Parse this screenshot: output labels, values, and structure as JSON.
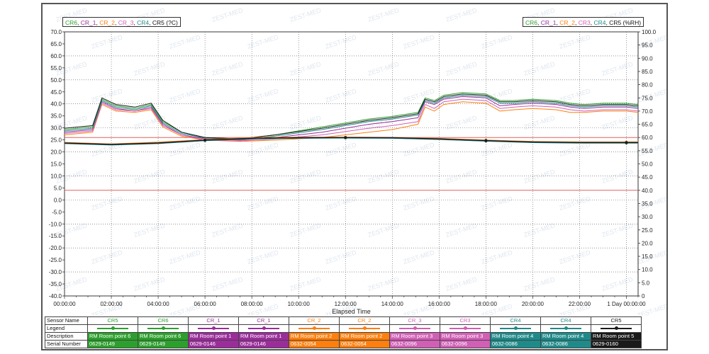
{
  "legend_left": {
    "items": [
      {
        "text": "CR6",
        "color": "#2ca02c"
      },
      {
        "text": ", ",
        "color": "#111111"
      },
      {
        "text": "CR_1",
        "color": "#9b2d9b"
      },
      {
        "text": ", ",
        "color": "#111111"
      },
      {
        "text": "CR_2",
        "color": "#ff7f0e"
      },
      {
        "text": ", ",
        "color": "#111111"
      },
      {
        "text": "CR_3",
        "color": "#d15fb6"
      },
      {
        "text": ", ",
        "color": "#111111"
      },
      {
        "text": "CR4",
        "color": "#1f8a8a"
      },
      {
        "text": ", CR5 (?C)",
        "color": "#111111"
      }
    ]
  },
  "legend_right": {
    "items": [
      {
        "text": "CR6",
        "color": "#2ca02c"
      },
      {
        "text": ", ",
        "color": "#111111"
      },
      {
        "text": "CR_1",
        "color": "#9b2d9b"
      },
      {
        "text": ", ",
        "color": "#111111"
      },
      {
        "text": "CR_2",
        "color": "#ff7f0e"
      },
      {
        "text": ", ",
        "color": "#111111"
      },
      {
        "text": "CR3",
        "color": "#d15fb6"
      },
      {
        "text": ", ",
        "color": "#111111"
      },
      {
        "text": "CR4",
        "color": "#1f8a8a"
      },
      {
        "text": ", CR5 (%RH)",
        "color": "#111111"
      }
    ]
  },
  "chart_data": {
    "type": "line",
    "xlabel": "Elapsed Time",
    "x_ticks": [
      "00:00:00",
      "02:00:00",
      "04:00:00",
      "06:00:00",
      "08:00:00",
      "10:00:00",
      "12:00:00",
      "14:00:00",
      "16:00:00",
      "18:00:00",
      "20:00:00",
      "22:00:00",
      "1 Day 00:00:00"
    ],
    "xlim_hours": [
      0,
      24.5
    ],
    "y_left": {
      "unit": "?C",
      "range": [
        -40,
        70
      ],
      "step": 5
    },
    "y_right": {
      "unit": "%RH",
      "range": [
        0,
        100
      ],
      "step": 5
    },
    "limit_lines_left_axis": [
      26,
      4
    ],
    "limit_color": "#e06060",
    "watermark": "ZEST-MED",
    "temperature_series": [
      {
        "name": "CR6",
        "color": "#2ca02c",
        "points": [
          [
            0,
            23.8
          ],
          [
            2,
            23.2
          ],
          [
            4,
            23.8
          ],
          [
            6,
            25.0
          ],
          [
            8,
            25.8
          ],
          [
            10,
            26.0
          ],
          [
            12,
            26.0
          ],
          [
            14,
            25.9
          ],
          [
            16,
            25.5
          ],
          [
            18,
            24.8
          ],
          [
            20,
            24.2
          ],
          [
            22,
            24.0
          ],
          [
            24,
            24.0
          ],
          [
            24.5,
            24.0
          ]
        ]
      },
      {
        "name": "CR_1",
        "color": "#9b2d9b",
        "points": [
          [
            0,
            23.6
          ],
          [
            2,
            23.0
          ],
          [
            4,
            23.6
          ],
          [
            6,
            24.8
          ],
          [
            8,
            25.6
          ],
          [
            10,
            25.8
          ],
          [
            12,
            25.9
          ],
          [
            14,
            25.8
          ],
          [
            16,
            25.3
          ],
          [
            18,
            24.6
          ],
          [
            20,
            24.0
          ],
          [
            22,
            23.8
          ],
          [
            24,
            23.8
          ],
          [
            24.5,
            23.8
          ]
        ]
      },
      {
        "name": "CR_2",
        "color": "#ff7f0e",
        "points": [
          [
            0,
            23.9
          ],
          [
            2,
            23.3
          ],
          [
            4,
            24.0
          ],
          [
            6,
            25.1
          ],
          [
            8,
            25.9
          ],
          [
            10,
            26.1
          ],
          [
            12,
            26.1
          ],
          [
            14,
            26.0
          ],
          [
            16,
            25.6
          ],
          [
            18,
            24.9
          ],
          [
            20,
            24.3
          ],
          [
            22,
            24.1
          ],
          [
            24,
            24.1
          ],
          [
            24.5,
            24.1
          ]
        ]
      },
      {
        "name": "CR_3",
        "color": "#d15fb6",
        "points": [
          [
            0,
            23.7
          ],
          [
            2,
            23.1
          ],
          [
            4,
            23.7
          ],
          [
            6,
            24.9
          ],
          [
            8,
            25.7
          ],
          [
            10,
            25.9
          ],
          [
            12,
            26.0
          ],
          [
            14,
            25.9
          ],
          [
            16,
            25.4
          ],
          [
            18,
            24.7
          ],
          [
            20,
            24.1
          ],
          [
            22,
            23.9
          ],
          [
            24,
            23.9
          ],
          [
            24.5,
            23.9
          ]
        ]
      },
      {
        "name": "CR4",
        "color": "#1f8a8a",
        "points": [
          [
            0,
            23.5
          ],
          [
            2,
            22.9
          ],
          [
            4,
            23.5
          ],
          [
            6,
            24.7
          ],
          [
            8,
            25.5
          ],
          [
            10,
            25.7
          ],
          [
            12,
            25.8
          ],
          [
            14,
            25.7
          ],
          [
            16,
            25.2
          ],
          [
            18,
            24.5
          ],
          [
            20,
            23.9
          ],
          [
            22,
            23.7
          ],
          [
            24,
            23.7
          ],
          [
            24.5,
            23.7
          ]
        ]
      },
      {
        "name": "CR5",
        "color": "#1a1a1a",
        "points": [
          [
            0,
            23.7
          ],
          [
            2,
            23.1
          ],
          [
            4,
            23.7
          ],
          [
            6,
            24.9
          ],
          [
            8,
            25.7
          ],
          [
            10,
            25.9
          ],
          [
            12,
            26.0
          ],
          [
            14,
            25.9
          ],
          [
            16,
            25.4
          ],
          [
            18,
            24.7
          ],
          [
            20,
            24.1
          ],
          [
            22,
            23.9
          ],
          [
            24,
            23.9
          ],
          [
            24.5,
            23.9
          ]
        ]
      }
    ],
    "humidity_series": [
      {
        "name": "CR6",
        "color": "#2ca02c",
        "points": [
          [
            0,
            63
          ],
          [
            1.2,
            64
          ],
          [
            1.6,
            74.5
          ],
          [
            2.2,
            72
          ],
          [
            3,
            71
          ],
          [
            3.7,
            72.5
          ],
          [
            4.2,
            66
          ],
          [
            5,
            62
          ],
          [
            6,
            60
          ],
          [
            7.5,
            59.5
          ],
          [
            9,
            61
          ],
          [
            11,
            64
          ],
          [
            13,
            67
          ],
          [
            14,
            68
          ],
          [
            15.1,
            69.5
          ],
          [
            15.4,
            75
          ],
          [
            15.8,
            74
          ],
          [
            16.2,
            76
          ],
          [
            17,
            77
          ],
          [
            18,
            76.5
          ],
          [
            18.6,
            74
          ],
          [
            19.2,
            74
          ],
          [
            20,
            74.5
          ],
          [
            21,
            74
          ],
          [
            21.6,
            73
          ],
          [
            22.2,
            72.5
          ],
          [
            23,
            73
          ],
          [
            24,
            73
          ],
          [
            24.5,
            72.5
          ]
        ]
      },
      {
        "name": "CR_1",
        "color": "#9b2d9b",
        "points": [
          [
            0,
            62
          ],
          [
            1.2,
            63
          ],
          [
            1.6,
            73.5
          ],
          [
            2.2,
            71
          ],
          [
            3,
            70
          ],
          [
            3.7,
            71.5
          ],
          [
            4.2,
            65
          ],
          [
            5,
            61
          ],
          [
            6,
            59.5
          ],
          [
            7.5,
            59
          ],
          [
            9,
            60
          ],
          [
            11,
            62
          ],
          [
            13,
            65
          ],
          [
            14,
            66
          ],
          [
            15.1,
            67.5
          ],
          [
            15.4,
            73.5
          ],
          [
            15.8,
            72.5
          ],
          [
            16.2,
            74.5
          ],
          [
            17,
            75.5
          ],
          [
            18,
            75
          ],
          [
            18.6,
            72
          ],
          [
            19.2,
            72.5
          ],
          [
            20,
            73
          ],
          [
            21,
            72.5
          ],
          [
            21.6,
            71.5
          ],
          [
            22.2,
            71
          ],
          [
            23,
            71.5
          ],
          [
            24,
            71.5
          ],
          [
            24.5,
            71
          ]
        ]
      },
      {
        "name": "CR_2",
        "color": "#ff7f0e",
        "points": [
          [
            0,
            61
          ],
          [
            1.2,
            62
          ],
          [
            1.6,
            72.5
          ],
          [
            2.2,
            70
          ],
          [
            3,
            69.5
          ],
          [
            3.7,
            70.5
          ],
          [
            4.2,
            64
          ],
          [
            5,
            60.5
          ],
          [
            6,
            59
          ],
          [
            7.5,
            58.5
          ],
          [
            9,
            59
          ],
          [
            11,
            60
          ],
          [
            13,
            62
          ],
          [
            14,
            63
          ],
          [
            15.1,
            65
          ],
          [
            15.4,
            71.5
          ],
          [
            15.8,
            70
          ],
          [
            16.2,
            72.5
          ],
          [
            17,
            73.5
          ],
          [
            18,
            73
          ],
          [
            18.6,
            70
          ],
          [
            19.2,
            70.5
          ],
          [
            20,
            71
          ],
          [
            21,
            70.5
          ],
          [
            21.6,
            69.5
          ],
          [
            22.2,
            69.5
          ],
          [
            23,
            70
          ],
          [
            24,
            70
          ],
          [
            24.5,
            69.5
          ]
        ]
      },
      {
        "name": "CR3",
        "color": "#d15fb6",
        "points": [
          [
            0,
            61.5
          ],
          [
            1.2,
            62.5
          ],
          [
            1.6,
            73
          ],
          [
            2.2,
            70.5
          ],
          [
            3,
            70
          ],
          [
            3.7,
            71
          ],
          [
            4.2,
            64.5
          ],
          [
            5,
            61
          ],
          [
            6,
            59
          ],
          [
            7.5,
            58.7
          ],
          [
            9,
            59.5
          ],
          [
            11,
            61
          ],
          [
            13,
            63.5
          ],
          [
            14,
            64.5
          ],
          [
            15.1,
            66
          ],
          [
            15.4,
            72.5
          ],
          [
            15.8,
            71
          ],
          [
            16.2,
            73.5
          ],
          [
            17,
            74.5
          ],
          [
            18,
            74
          ],
          [
            18.6,
            71
          ],
          [
            19.2,
            71.5
          ],
          [
            20,
            72
          ],
          [
            21,
            71.5
          ],
          [
            21.6,
            70.5
          ],
          [
            22.2,
            70
          ],
          [
            23,
            70.5
          ],
          [
            24,
            70.5
          ],
          [
            24.5,
            70
          ]
        ]
      },
      {
        "name": "CR4",
        "color": "#1f8a8a",
        "points": [
          [
            0,
            62.5
          ],
          [
            1.2,
            63.5
          ],
          [
            1.6,
            74
          ],
          [
            2.2,
            71.5
          ],
          [
            3,
            70.5
          ],
          [
            3.7,
            72
          ],
          [
            4.2,
            65.5
          ],
          [
            5,
            61.5
          ],
          [
            6,
            59.8
          ],
          [
            7.5,
            59.2
          ],
          [
            9,
            60.5
          ],
          [
            11,
            63
          ],
          [
            13,
            66
          ],
          [
            14,
            67
          ],
          [
            15.1,
            68.5
          ],
          [
            15.4,
            74
          ],
          [
            15.8,
            73
          ],
          [
            16.2,
            75
          ],
          [
            17,
            76
          ],
          [
            18,
            75.5
          ],
          [
            18.6,
            73
          ],
          [
            19.2,
            73
          ],
          [
            20,
            73.5
          ],
          [
            21,
            73
          ],
          [
            21.6,
            72
          ],
          [
            22.2,
            71.5
          ],
          [
            23,
            72
          ],
          [
            24,
            72
          ],
          [
            24.5,
            71.5
          ]
        ]
      },
      {
        "name": "CR5",
        "color": "#1a1a1a",
        "points": [
          [
            0,
            63.5
          ],
          [
            1.2,
            64.5
          ],
          [
            1.6,
            75
          ],
          [
            2.2,
            72.5
          ],
          [
            3,
            71.5
          ],
          [
            3.7,
            73
          ],
          [
            4.2,
            66.5
          ],
          [
            5,
            62
          ],
          [
            6,
            60
          ],
          [
            7.5,
            59.5
          ],
          [
            9,
            61
          ],
          [
            11,
            63.5
          ],
          [
            13,
            66.5
          ],
          [
            14,
            67.5
          ],
          [
            15.1,
            69
          ],
          [
            15.4,
            74.5
          ],
          [
            15.8,
            73.5
          ],
          [
            16.2,
            75.5
          ],
          [
            17,
            76.5
          ],
          [
            18,
            76
          ],
          [
            18.6,
            73.5
          ],
          [
            19.2,
            73.5
          ],
          [
            20,
            74
          ],
          [
            21,
            73.5
          ],
          [
            21.6,
            72.5
          ],
          [
            22.2,
            72
          ],
          [
            23,
            72.5
          ],
          [
            24,
            72.5
          ],
          [
            24.5,
            72
          ]
        ]
      }
    ]
  },
  "table": {
    "row_labels": [
      "Sensor Name",
      "Legend",
      "Description",
      "Serial Number"
    ],
    "columns": [
      {
        "sensor": "CR5",
        "description": "RM Room point 6",
        "serial": "0629-0149",
        "color": "#2ca02c"
      },
      {
        "sensor": "CR6",
        "description": "RM Room point 6",
        "serial": "0629-0149",
        "color": "#2ca02c"
      },
      {
        "sensor": "CR_1",
        "description": "RM Room point 1",
        "serial": "0629-0146",
        "color": "#9b2d9b"
      },
      {
        "sensor": "CR_1",
        "description": "RM Room point 1",
        "serial": "0629-0146",
        "color": "#9b2d9b"
      },
      {
        "sensor": "CR_2",
        "description": "RM Room point 2",
        "serial": "0632-0054",
        "color": "#ff7f0e"
      },
      {
        "sensor": "CR_2",
        "description": "RM Room point 2",
        "serial": "0632-0054",
        "color": "#ff7f0e"
      },
      {
        "sensor": "CR_3",
        "description": "RM Room point 3",
        "serial": "0632-0096",
        "color": "#d15fb6"
      },
      {
        "sensor": "CR3",
        "description": "RM Room point 3",
        "serial": "0632-0096",
        "color": "#d15fb6"
      },
      {
        "sensor": "CR4",
        "description": "RM Room point 4",
        "serial": "0632-0086",
        "color": "#1f8a8a"
      },
      {
        "sensor": "CR4",
        "description": "RM Room point 4",
        "serial": "0632-0086",
        "color": "#1f8a8a"
      },
      {
        "sensor": "CR5",
        "description": "RM Room point 5",
        "serial": "0629-0160",
        "color": "#1a1a1a"
      }
    ]
  }
}
